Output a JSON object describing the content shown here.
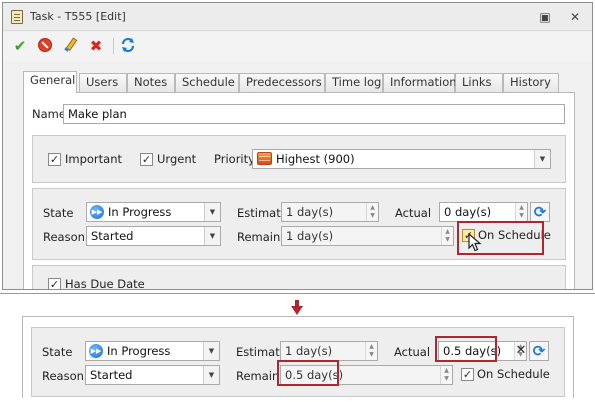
{
  "window": {
    "title": "Task - T555 [Edit]",
    "restore_glyph": "▣",
    "close_glyph": "✕"
  },
  "toolbar": {
    "icons": [
      "save-icon",
      "cancel-icon",
      "edit-icon",
      "delete-icon",
      "refresh-icon"
    ]
  },
  "tabs": [
    "General",
    "Users",
    "Notes",
    "Schedule",
    "Predecessors",
    "Time log",
    "Information",
    "Links",
    "History"
  ],
  "general": {
    "name_label": "Name",
    "name_value": "Make plan",
    "important_label": "Important",
    "important_checked": true,
    "urgent_label": "Urgent",
    "urgent_checked": true,
    "priority_label": "Priority",
    "priority_value": "Highest (900)",
    "state_label": "State",
    "state_value": "In Progress",
    "reason_label": "Reason",
    "reason_value": "Started",
    "estimate_label": "Estimate",
    "estimate_value": "1 day(s)",
    "remain_label": "Remain",
    "remain_value": "1 day(s)",
    "actual_label": "Actual",
    "actual_value": "0 day(s)",
    "on_schedule_label": "On Schedule",
    "on_schedule_checked": true,
    "has_due_date_label": "Has Due Date",
    "has_due_date_checked": true
  },
  "after": {
    "state_label": "State",
    "state_value": "In Progress",
    "reason_label": "Reason",
    "reason_value": "Started",
    "estimate_label": "Estimate",
    "estimate_value": "1 day(s)",
    "remain_label": "Remain",
    "remain_value": "0.5 day(s)",
    "actual_label": "Actual",
    "actual_value": "0.5 day(s)",
    "on_schedule_label": "On Schedule",
    "on_schedule_checked": true,
    "clear_glyph": "✕"
  },
  "colors": {
    "highlight": "#b0262e",
    "arrow": "#b0262e",
    "accent_blue": "#1c7bd8"
  }
}
